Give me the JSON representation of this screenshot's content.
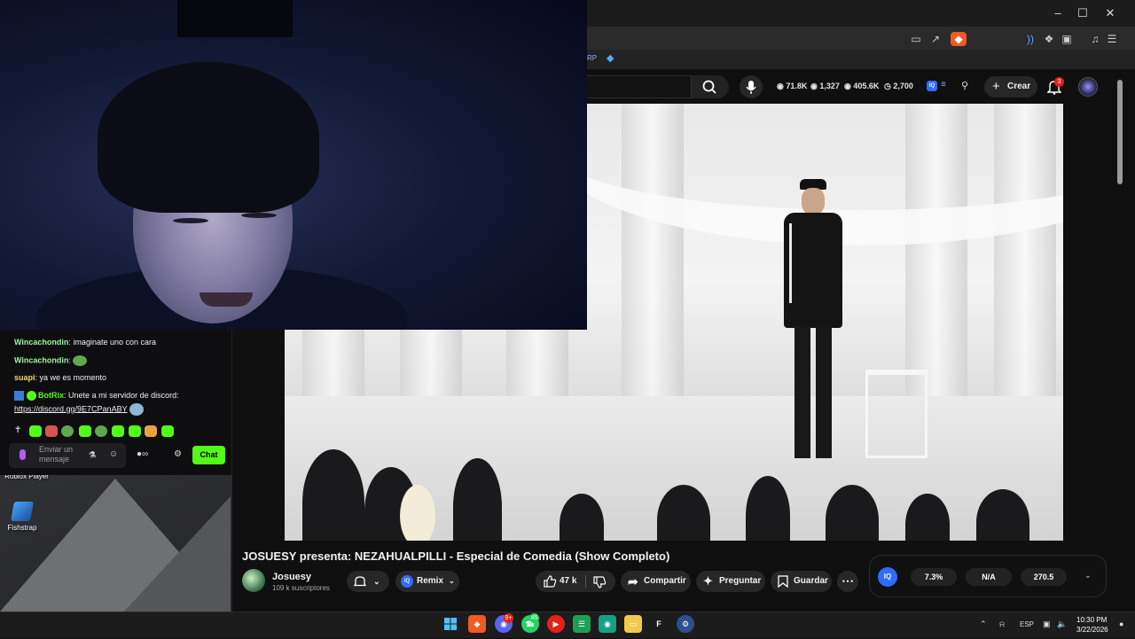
{
  "browser": {
    "bookmark_fragment": "RP"
  },
  "youtube": {
    "stats": [
      {
        "icon": "eye-icon",
        "value": "71.8K"
      },
      {
        "icon": "thumbs-up-stat-icon",
        "value": "1,327"
      },
      {
        "icon": "eye-icon",
        "value": "405.6K"
      },
      {
        "icon": "clock-icon",
        "value": "2,700"
      }
    ],
    "create_label": "Crear",
    "notification_count": "3",
    "video_title": "JOSUESY presenta: NEZAHUALPILLI - Especial de Comedia (Show Completo)",
    "channel_name": "Josuesy",
    "subscribers": "109 k suscriptores",
    "remix_label": "Remix",
    "remix_badge": "IQ",
    "likes": "47 k",
    "share_label": "Compartir",
    "ask_label": "Preguntar",
    "save_label": "Guardar",
    "iq_panel": {
      "badge": "IQ",
      "values": [
        "7.3%",
        "N/A",
        "270.5"
      ]
    }
  },
  "chat": {
    "messages": [
      {
        "user": "Wincachondin",
        "user_color": "#9ef0a6",
        "text": "imaginate uno con cara"
      },
      {
        "user": "Wincachondin",
        "user_color": "#9ef0a6",
        "text": ""
      },
      {
        "user": "suapi",
        "user_color": "#f5d76e",
        "text": "ya we es momento"
      },
      {
        "user": "BotRix",
        "user_color": "#53fc18",
        "text": "Unete a mi servidor de discord:"
      }
    ],
    "link": "https://discord.gg/9E7CPanABY",
    "input_placeholder": "Enviar un mensaje",
    "send_label": "Chat",
    "colors": {
      "accent": "#53fc18",
      "background": "#0e0e10"
    }
  },
  "desktop": {
    "icons": [
      {
        "label": "Roblox Player"
      },
      {
        "label": "Fishstrap"
      }
    ]
  },
  "taskbar": {
    "discord_badge": "9+",
    "whatsapp_badge": "45",
    "language": "ESP",
    "time": "10:30 PM",
    "date": "3/22/2026"
  }
}
